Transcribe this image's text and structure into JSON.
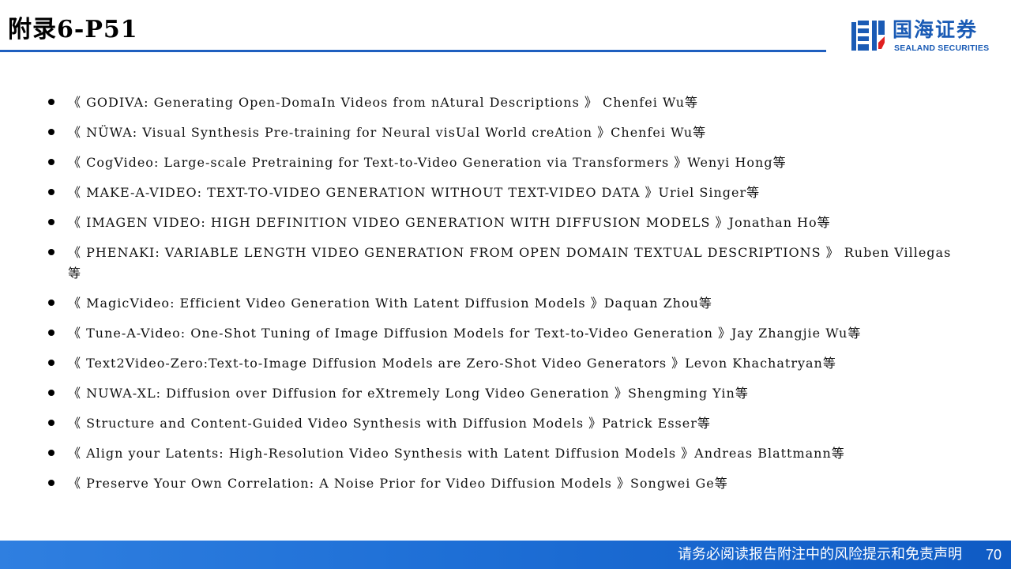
{
  "header": {
    "title": "附录6-P51",
    "logo": {
      "name_cn": "国海证券",
      "name_en": "SEALAND SECURITIES",
      "icon": "sealand-mark-icon",
      "brand_color": "#1a5bb5"
    },
    "rule_color": "#1f5fbf"
  },
  "references": [
    "《 GODIVA: Generating Open-DomaIn Videos from nAtural Descriptions 》 Chenfei Wu等",
    "《 NÜWA: Visual Synthesis Pre-training for Neural visUal World creAtion 》Chenfei Wu等",
    "《 CogVideo: Large-scale Pretraining for Text-to-Video Generation via Transformers 》Wenyi Hong等",
    "《 MAKE-A-VIDEO: TEXT-TO-VIDEO GENERATION WITHOUT TEXT-VIDEO DATA 》Uriel Singer等",
    "《 IMAGEN VIDEO: HIGH DEFINITION VIDEO GENERATION WITH DIFFUSION MODELS 》Jonathan Ho等",
    "《 PHENAKI: VARIABLE LENGTH VIDEO GENERATION FROM OPEN DOMAIN TEXTUAL DESCRIPTIONS 》 Ruben Villegas等",
    "《 MagicVideo: Efficient Video Generation With Latent Diffusion Models 》Daquan Zhou等",
    "《 Tune-A-Video: One-Shot Tuning of Image Diffusion Models for Text-to-Video Generation 》Jay Zhangjie Wu等",
    "《 Text2Video-Zero:Text-to-Image Diffusion Models are Zero-Shot Video Generators 》Levon Khachatryan等",
    "《 NUWA-XL: Diffusion over Diffusion for eXtremely Long Video Generation 》Shengming Yin等",
    "《 Structure and Content-Guided Video Synthesis with Diffusion Models 》Patrick Esser等",
    "《 Align your Latents: High-Resolution Video Synthesis with Latent Diffusion Models 》Andreas Blattmann等",
    "《 Preserve Your Own Correlation: A Noise Prior for Video Diffusion Models 》Songwei Ge等"
  ],
  "footer": {
    "disclaimer": "请务必阅读报告附注中的风险提示和免责声明",
    "page_number": "70",
    "bar_color": "#1e6fd6"
  }
}
